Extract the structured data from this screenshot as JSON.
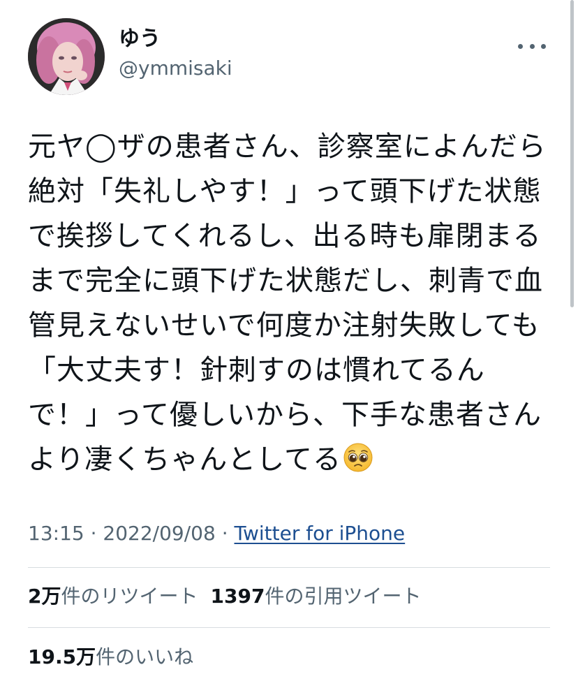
{
  "user": {
    "display_name": "ゆう",
    "handle": "@ymmisaki"
  },
  "tweet": {
    "text": "元ヤ◯ザの患者さん、診察室によんだら絶対「失礼しやす！」って頭下げた状態で挨拶してくれるし、出る時も扉閉まるまで完全に頭下げた状態だし、刺青で血管見えないせいで何度か注射失敗しても「大丈夫す！針刺すのは慣れてるんで！」って優しいから、下手な患者さんより凄くちゃんとしてる",
    "emoji": "pleading-face-emoji"
  },
  "meta": {
    "time": "13:15",
    "separator": " · ",
    "date": "2022/09/08",
    "source": "Twitter for iPhone"
  },
  "stats": {
    "retweets_count": "2",
    "retweets_unit": "万",
    "retweets_label": "件のリツイート",
    "quotes_count": "1397",
    "quotes_label": "件の引用ツイート",
    "likes_count": "19.5",
    "likes_unit": "万",
    "likes_label": "件のいいね"
  },
  "icons": {
    "more": "more-horizontal-icon"
  }
}
